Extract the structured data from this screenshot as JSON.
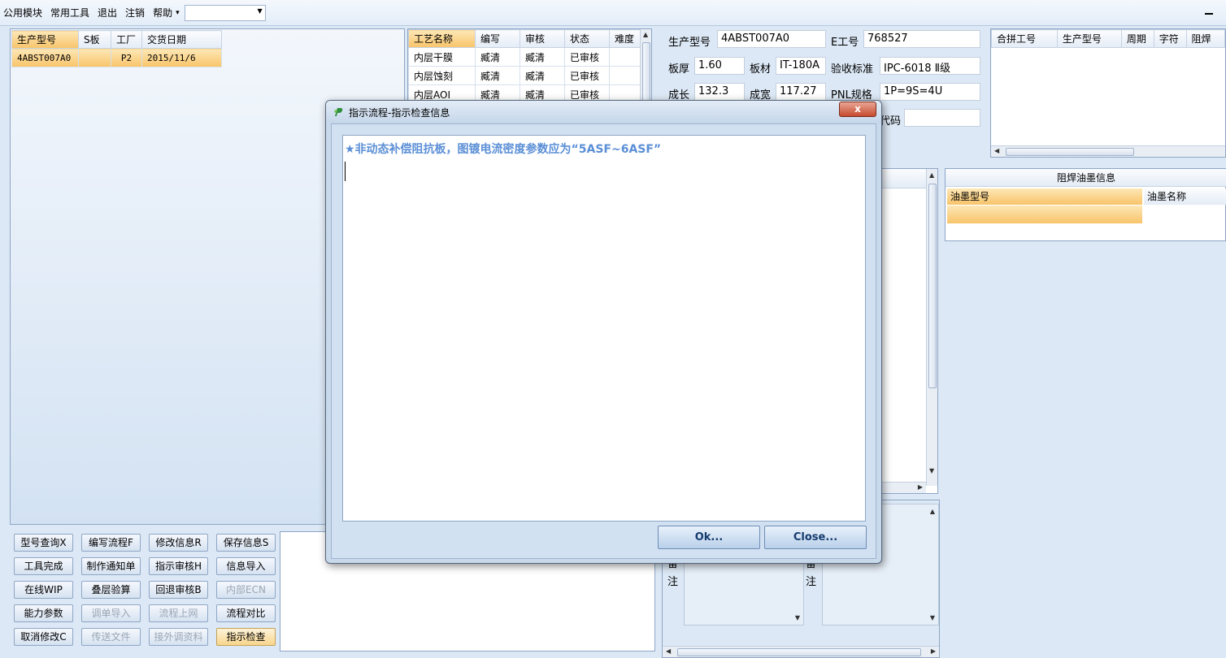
{
  "menu": {
    "items": [
      "公用模块",
      "常用工具",
      "退出",
      "注销",
      "帮助"
    ],
    "help_arrow": "▾",
    "combo_value": ""
  },
  "left_grid": {
    "columns": [
      "生产型号",
      "S板",
      "工厂",
      "交货日期"
    ],
    "rows": [
      [
        "4ABST007A0",
        "",
        "P2",
        "2015/11/6"
      ]
    ]
  },
  "process_grid": {
    "columns": [
      "工艺名称",
      "编写",
      "审核",
      "状态",
      "难度"
    ],
    "rows": [
      [
        "内层干膜",
        "臧清",
        "臧清",
        "已审核",
        ""
      ],
      [
        "内层蚀刻",
        "臧清",
        "臧清",
        "已审核",
        ""
      ],
      [
        "内层AOI",
        "臧清",
        "臧清",
        "已审核",
        ""
      ]
    ]
  },
  "info": {
    "model_label": "生产型号",
    "model_value": "4ABST007A0",
    "e_label": "E工号",
    "e_value": "768527",
    "thick_label": "板厚",
    "thick_value": "1.60",
    "mat_label": "板材",
    "mat_value": "IT-180A",
    "std_label": "验收标准",
    "std_value": "IPC-6018 Ⅱ级",
    "len_label": "成长",
    "len_value": "132.3",
    "wid_label": "成宽",
    "wid_value": "117.27",
    "pnl_label": "PNL规格",
    "pnl_value": "1P=9S=4U",
    "code_label": "代码",
    "code_value": ""
  },
  "merge_grid": {
    "columns": [
      "合拼工号",
      "生产型号",
      "周期",
      "字符",
      "阻焊"
    ]
  },
  "ink_panel": {
    "title": "阻焊油墨信息",
    "columns": [
      "油墨型号",
      "油墨名称"
    ]
  },
  "remarks": {
    "label_a": "备注",
    "label_b": "备注"
  },
  "buttons": [
    {
      "label": "型号查询X",
      "disabled": false
    },
    {
      "label": "编写流程F",
      "disabled": false
    },
    {
      "label": "修改信息R",
      "disabled": false
    },
    {
      "label": "保存信息S",
      "disabled": false
    },
    {
      "label": "工具完成",
      "disabled": false
    },
    {
      "label": "制作通知单",
      "disabled": false
    },
    {
      "label": "指示审核H",
      "disabled": false
    },
    {
      "label": "信息导入",
      "disabled": false
    },
    {
      "label": "在线WIP",
      "disabled": false
    },
    {
      "label": "叠层验算",
      "disabled": false
    },
    {
      "label": "回退审核B",
      "disabled": false
    },
    {
      "label": "内部ECN",
      "disabled": true
    },
    {
      "label": "能力参数",
      "disabled": false
    },
    {
      "label": "调单导入",
      "disabled": true
    },
    {
      "label": "流程上网",
      "disabled": true
    },
    {
      "label": "流程对比",
      "disabled": false
    },
    {
      "label": "取消修改C",
      "disabled": false
    },
    {
      "label": "传送文件",
      "disabled": true
    },
    {
      "label": "接外调资料",
      "disabled": true
    },
    {
      "label": "指示检查",
      "disabled": false
    }
  ],
  "dialog": {
    "title": "指示流程-指示检查信息",
    "message": "★非动态补偿阻抗板，图镀电流密度参数应为“5ASF~6ASF”",
    "ok_label": "Ok...",
    "close_label": "Close...",
    "close_x": "x"
  },
  "colors": {
    "message_text": "#5b8fd6",
    "selection": "#f8c46a",
    "panel_border": "#8ea6c6"
  }
}
